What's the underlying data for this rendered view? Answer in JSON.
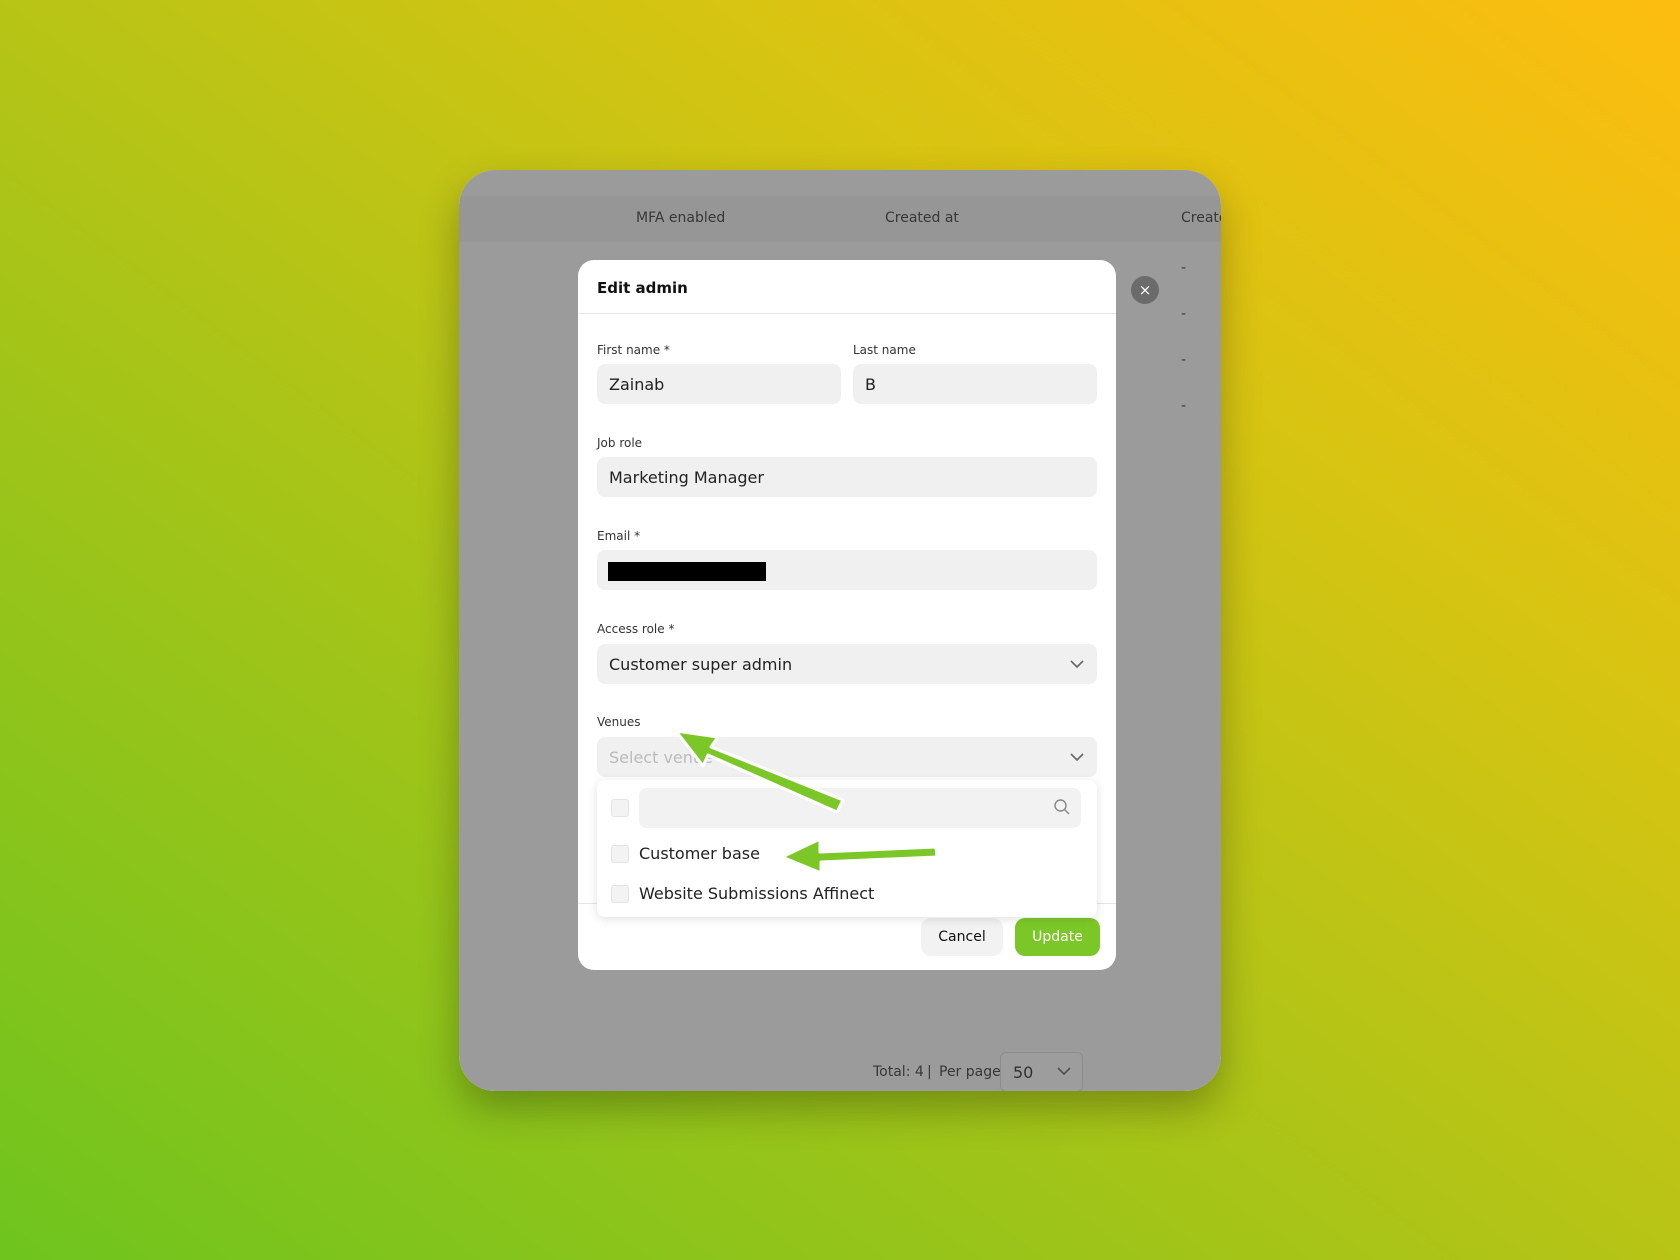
{
  "background_table": {
    "headers": [
      "MFA enabled",
      "Created at",
      "Create"
    ],
    "dashes": [
      "-",
      "-",
      "-",
      "-"
    ],
    "footer": {
      "total": "Total: 4",
      "separator": "|",
      "per_page_label": "Per page:",
      "per_page_value": "50"
    }
  },
  "modal": {
    "title": "Edit admin",
    "close_symbol": "×",
    "first_name": {
      "label": "First name *",
      "value": "Zainab"
    },
    "last_name": {
      "label": "Last name",
      "value": "B"
    },
    "job_role": {
      "label": "Job role",
      "value": "Marketing Manager"
    },
    "email": {
      "label": "Email *",
      "value": ""
    },
    "access_role": {
      "label": "Access role *",
      "value": "Customer super admin"
    },
    "venues": {
      "label": "Venues",
      "placeholder": "Select venue",
      "options": [
        "Customer base",
        "Website Submissions Affinect"
      ]
    },
    "cancel_label": "Cancel",
    "update_label": "Update"
  },
  "colors": {
    "accent": "#7cc728",
    "overlay": "#3c3c3c",
    "arrow": "#7cc728"
  },
  "icons": {
    "select": "chevron-down-icon",
    "search": "search-icon",
    "close": "close-icon"
  }
}
